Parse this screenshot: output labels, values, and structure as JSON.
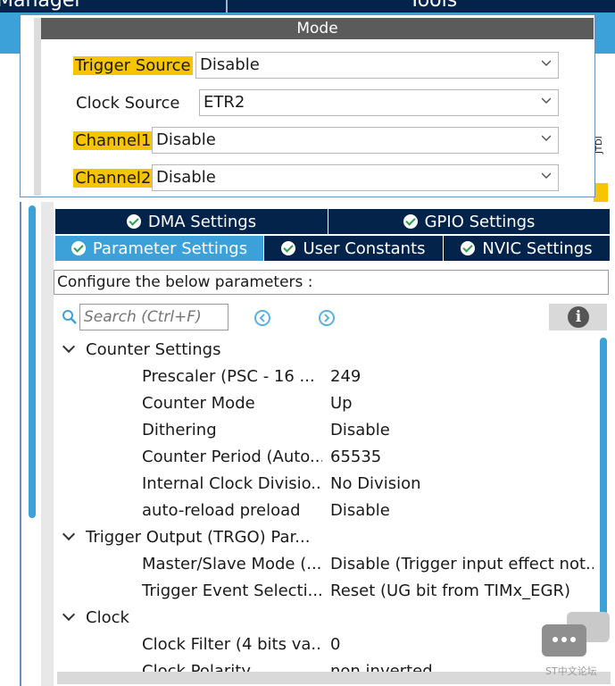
{
  "top_header": {
    "left_title": "Manager",
    "right_title": "Tools"
  },
  "mode": {
    "header": "Mode",
    "fields": [
      {
        "label": "Trigger Source",
        "value": "Disable",
        "highlighted": true
      },
      {
        "label": "Clock Source",
        "value": "ETR2",
        "highlighted": false
      },
      {
        "label": "Channel1",
        "value": "Disable",
        "highlighted": true
      },
      {
        "label": "Channel2",
        "value": "Disable",
        "highlighted": true
      }
    ]
  },
  "pin_label": "JTDI",
  "configuration": {
    "tabs_row1": [
      "DMA Settings",
      "GPIO Settings"
    ],
    "tabs_row2": [
      "Parameter Settings",
      "User Constants",
      "NVIC Settings"
    ],
    "active_tab": "Parameter Settings",
    "description": "Configure the below parameters :",
    "search_placeholder": "Search (Ctrl+F)",
    "info_label": "i",
    "groups": [
      {
        "title": "Counter Settings",
        "params": [
          {
            "name": "Prescaler (PSC - 16 ...",
            "value": "249"
          },
          {
            "name": "Counter Mode",
            "value": "Up"
          },
          {
            "name": "Dithering",
            "value": "Disable"
          },
          {
            "name": "Counter Period (Auto...",
            "value": "65535"
          },
          {
            "name": "Internal Clock Divisio...",
            "value": "No Division"
          },
          {
            "name": "auto-reload preload",
            "value": "Disable"
          }
        ]
      },
      {
        "title": "Trigger Output (TRGO) Par...",
        "params": [
          {
            "name": "Master/Slave Mode (...",
            "value": "Disable (Trigger input effect not..."
          },
          {
            "name": "Trigger Event Selecti...",
            "value": "Reset (UG bit from TIMx_EGR)"
          }
        ]
      },
      {
        "title": "Clock",
        "params": [
          {
            "name": "Clock Filter (4 bits va...",
            "value": "0"
          },
          {
            "name": "Clock Polarity",
            "value": "non inverted"
          }
        ]
      }
    ]
  },
  "watermark_text": "ST中文论坛",
  "colors": {
    "navy": "#03234b",
    "accent_blue": "#3ca1d8",
    "highlight": "#f7c400",
    "check_green": "#2e9e4f"
  }
}
